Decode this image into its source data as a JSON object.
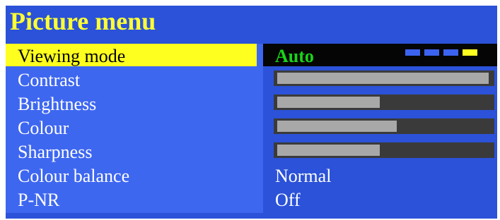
{
  "menu": {
    "title": "Picture menu",
    "viewing_mode": {
      "label": "Viewing mode",
      "value": "Auto",
      "indicator": {
        "count": 4,
        "active_index": 3
      }
    },
    "contrast": {
      "label": "Contrast",
      "level": 0.99
    },
    "brightness": {
      "label": "Brightness",
      "level": 0.48
    },
    "colour": {
      "label": "Colour",
      "level": 0.56
    },
    "sharpness": {
      "label": "Sharpness",
      "level": 0.48
    },
    "colour_balance": {
      "label": "Colour balance",
      "value": "Normal"
    },
    "pnr": {
      "label": "P-NR",
      "value": "Off"
    }
  },
  "colors": {
    "background": "#2b52d8",
    "left_column": "#3e67f0",
    "title": "#ffff33",
    "highlight": "#ffff1f",
    "highlight_value_bg": "#050505",
    "selected_value": "#19d419",
    "bar_track": "#3a3a3a",
    "bar_fill": "#a8a8a8",
    "indicator_inactive": "#3b63f0"
  }
}
